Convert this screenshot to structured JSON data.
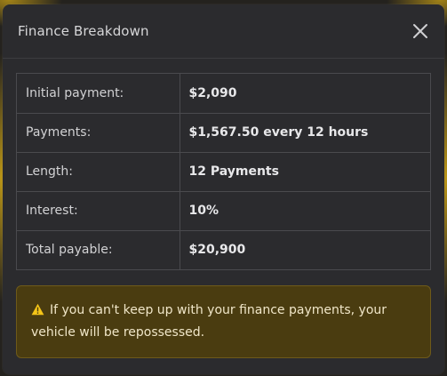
{
  "modal": {
    "title": "Finance Breakdown",
    "close_icon": "close-icon"
  },
  "breakdown": [
    {
      "label": "Initial payment:",
      "value": "$2,090"
    },
    {
      "label": "Payments:",
      "value": "$1,567.50 every 12 hours"
    },
    {
      "label": "Length:",
      "value": "12 Payments"
    },
    {
      "label": "Interest:",
      "value": "10%"
    },
    {
      "label": "Total payable:",
      "value": "$20,900"
    }
  ],
  "warning": {
    "icon": "warning-icon",
    "text": "If you can't keep up with your finance payments, your vehicle will be repossessed."
  },
  "colors": {
    "warning_bg": "#4a3c10",
    "warning_icon": "#f5c518"
  }
}
